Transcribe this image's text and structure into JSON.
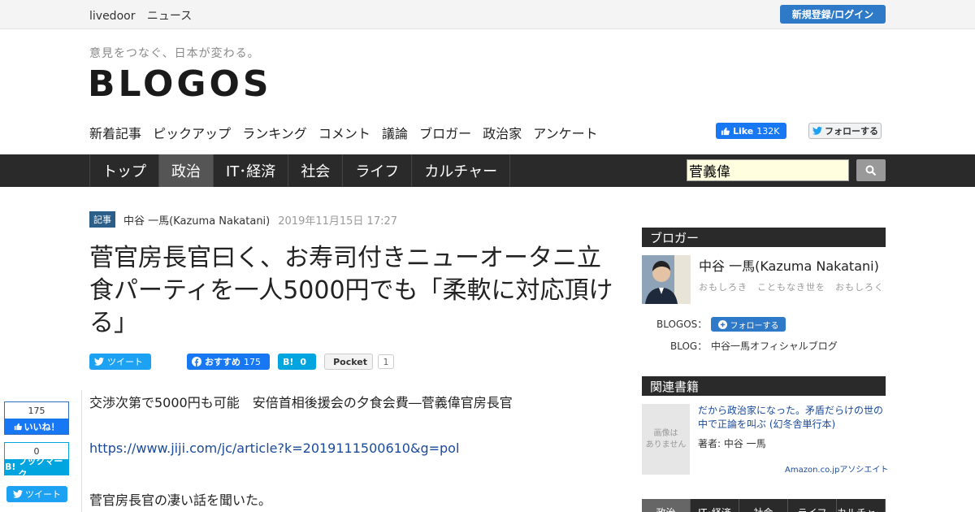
{
  "header": {
    "brand": [
      "livedoor",
      "ニュース"
    ],
    "login_label": "新規登録/ログイン",
    "tagline": "意見をつなぐ、日本が変わる。",
    "logo": "BLOGOS",
    "subnav": [
      "新着記事",
      "ピックアップ",
      "ランキング",
      "コメント",
      "議論",
      "ブロガー",
      "政治家",
      "アンケート"
    ],
    "fb_like": {
      "label": "Like",
      "count": "132K"
    },
    "tw_follow_label": "フォローする"
  },
  "mainnav": {
    "items": [
      "トップ",
      "政治",
      "IT･経済",
      "社会",
      "ライフ",
      "カルチャー"
    ],
    "active_index": 1
  },
  "search": {
    "value": "菅義偉"
  },
  "article": {
    "tag": "記事",
    "author": "中谷 一馬(Kazuma Nakatani)",
    "date": "2019年11月15日 17:27",
    "title": "菅官房長官曰く、お寿司付きニューオータニ立食パーティを一人5000円でも「柔軟に対応頂ける」",
    "share": {
      "tweet": "ツイート",
      "fb_label": "おすすめ",
      "fb_count": "175",
      "hatena_count": "0",
      "pocket_label": "Pocket",
      "pocket_count": "1"
    },
    "body": [
      "交渉次第で5000円も可能　安倍首相後援会の夕食会費―菅義偉官房長官",
      "https://www.jiji.com/jc/article?k=2019111500610&g=pol",
      "菅官房長官の凄い話を聞いた。"
    ]
  },
  "floating": {
    "fb_count": "175",
    "fb_label": "いいね！",
    "hatena_count": "0",
    "hatena_label": "ブックマーク",
    "tweet": "ツイート"
  },
  "sidebar": {
    "blogger_head": "ブロガー",
    "blogger_name": "中谷 一馬(Kazuma Nakatani)",
    "blogger_desc": "おもしろき　こともなき世を　おもしろく",
    "blogos_label": "BLOGOS：",
    "follow_label": "フォローする",
    "blog_label": "BLOG：",
    "blog_name": "中谷一馬オフィシャルブログ",
    "books_head": "関連書籍",
    "book_placeholder": "画像は\nありません",
    "book_title": "だから政治家になった。矛盾だらけの世の中で正論を叫ぶ (幻冬舎単行本)",
    "book_author": "著者: 中谷 一馬",
    "amazon": "Amazon.co.jpアソシエイト",
    "cat_tabs": [
      "政治",
      "IT･経済",
      "社会",
      "ライフ",
      "カルチャー"
    ]
  },
  "colors": {
    "accent": "#2f7ac8",
    "nav": "#2a2a2a",
    "link": "#1a4a9a",
    "tag": "#2b5f8a"
  }
}
